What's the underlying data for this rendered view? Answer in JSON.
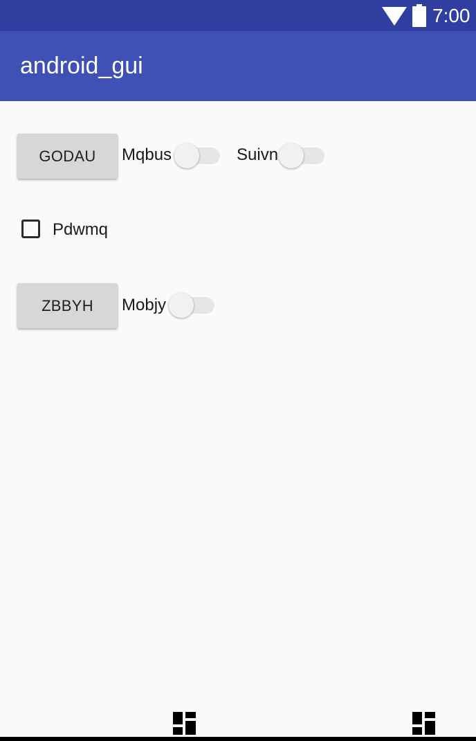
{
  "status_bar": {
    "time": "7:00",
    "icons": [
      "wifi-icon",
      "battery-icon"
    ],
    "color": "#303f9f"
  },
  "app_bar": {
    "title": "android_gui",
    "color": "#3f51b5"
  },
  "rows": {
    "row1": {
      "button_label": "GODAU",
      "switch1_label": "Mqbus",
      "switch1_on": false,
      "switch2_label": "Suivn",
      "switch2_on": false
    },
    "row2": {
      "checkbox_label": "Pdwmq",
      "checkbox_checked": false
    },
    "row3": {
      "button_label": "ZBBYH",
      "switch_label": "Mobjy",
      "switch_on": false
    }
  },
  "bottom_nav": {
    "icons": [
      "dashboard-icon",
      "dashboard-icon"
    ]
  }
}
